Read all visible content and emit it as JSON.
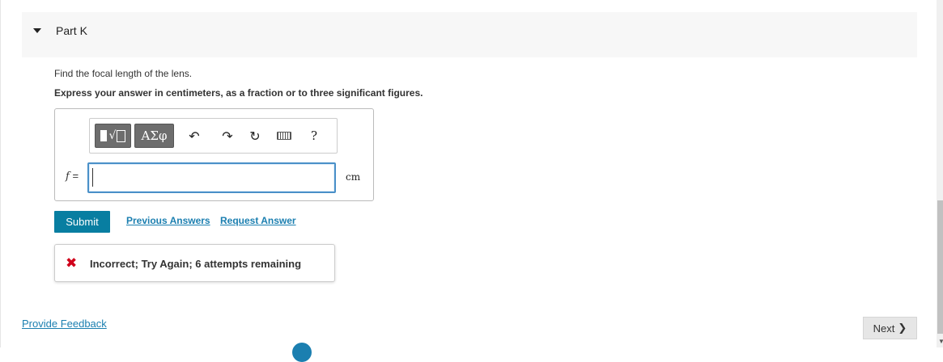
{
  "part": {
    "title": "Part K"
  },
  "question": {
    "text": "Find the focal length of the lens.",
    "instruction": "Express your answer in centimeters, as a fraction or to three significant figures."
  },
  "toolbar": {
    "greek_label": "ΑΣφ",
    "help_label": "?",
    "undo_glyph": "↶",
    "redo_glyph": "↷",
    "reset_glyph": "↻"
  },
  "answer": {
    "variable": "f",
    "equals": "=",
    "value": "",
    "unit": "cm"
  },
  "actions": {
    "submit_label": "Submit",
    "previous_answers_label": "Previous Answers",
    "request_answer_label": "Request Answer"
  },
  "feedback": {
    "icon_glyph": "✖",
    "message": "Incorrect; Try Again; 6 attempts remaining"
  },
  "footer": {
    "provide_feedback_label": "Provide Feedback",
    "next_label": "Next",
    "next_glyph": "❯"
  },
  "colors": {
    "accent": "#087ea1",
    "link": "#1b7fb0",
    "error": "#d0021b"
  }
}
